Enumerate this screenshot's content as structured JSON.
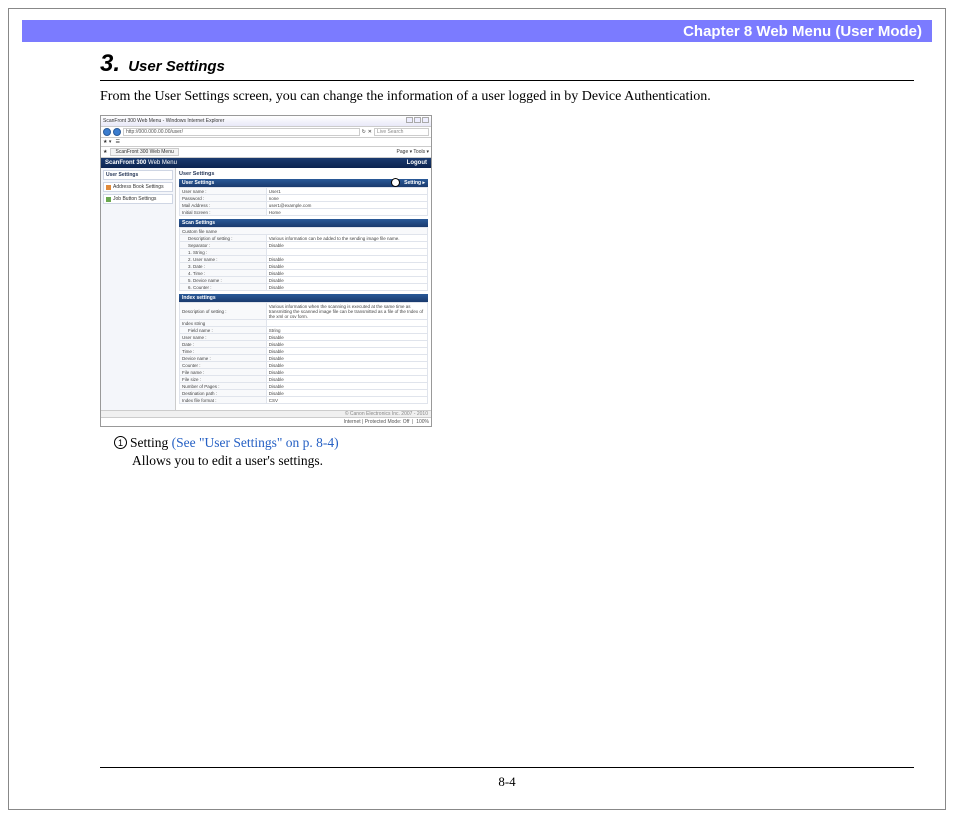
{
  "header": {
    "chapter": "Chapter 8   Web Menu (User Mode)"
  },
  "section": {
    "number": "3.",
    "title": "User Settings"
  },
  "intro": "From the User Settings screen, you can change the information of a user logged in by Device Authentication.",
  "screenshot": {
    "window_title": "ScanFront 300 Web Menu - Windows Internet Explorer",
    "url": "http://000.000.00.00/user/",
    "search_placeholder": "Live Search",
    "tab_label": "ScanFront 300 Web Menu",
    "toolbar_items": "Page ▾   Tools ▾",
    "app_name": "ScanFront 300",
    "app_subtitle": "Web Menu",
    "logout": "Logout",
    "sidebar": {
      "head": "User Settings",
      "addr": "Address Book Settings",
      "job": "Job Button Settings"
    },
    "main_title": "User Settings",
    "user_settings": {
      "title": "User Settings",
      "setting_link": "Setting ▸",
      "rows": [
        [
          "User name :",
          "User1"
        ],
        [
          "Password :",
          "none"
        ],
        [
          "Mail Address :",
          "user1@example.com"
        ],
        [
          "Initial Screen :",
          "Home"
        ]
      ]
    },
    "scan_settings": {
      "title": "Scan Settings",
      "subhead": "Custom file name",
      "rows": [
        [
          "Description of setting :",
          "Various information can be added to the sending image file name."
        ],
        [
          "Separator :",
          "Disable"
        ],
        [
          "1. String :",
          ""
        ],
        [
          "2. User name :",
          "Disable"
        ],
        [
          "3. Date :",
          "Disable"
        ],
        [
          "4. Time :",
          "Disable"
        ],
        [
          "5. Device name :",
          "Disable"
        ],
        [
          "6. Counter :",
          "Disable"
        ]
      ]
    },
    "index_settings": {
      "title": "Index settings",
      "rows": [
        [
          "Description of setting :",
          "Various information when the scanning is executed at the same time as transmitting the scanned image file can be transmitted as a file of the Index of the xml or csv form."
        ],
        [
          "Index string",
          ""
        ],
        [
          "Field name :",
          "String"
        ],
        [
          "User name :",
          "Disable"
        ],
        [
          "Date :",
          "Disable"
        ],
        [
          "Time :",
          "Disable"
        ],
        [
          "Device name :",
          "Disable"
        ],
        [
          "Counter :",
          "Disable"
        ],
        [
          "File name :",
          "Disable"
        ],
        [
          "File size :",
          "Disable"
        ],
        [
          "Number of Pages :",
          "Disable"
        ],
        [
          "Destination path :",
          "Disable"
        ],
        [
          "Index file format :",
          "CSV"
        ]
      ]
    },
    "copyright": "© Canon Electronics Inc. 2007 - 2010",
    "status": "Internet | Protected Mode: Off",
    "zoom": "100%"
  },
  "callout_num": "1",
  "annotation": {
    "num": "1",
    "label": "Setting ",
    "link": "(See \"User Settings\" on p. 8-4)",
    "desc": "Allows you to edit a user's settings."
  },
  "page_number": "8-4"
}
